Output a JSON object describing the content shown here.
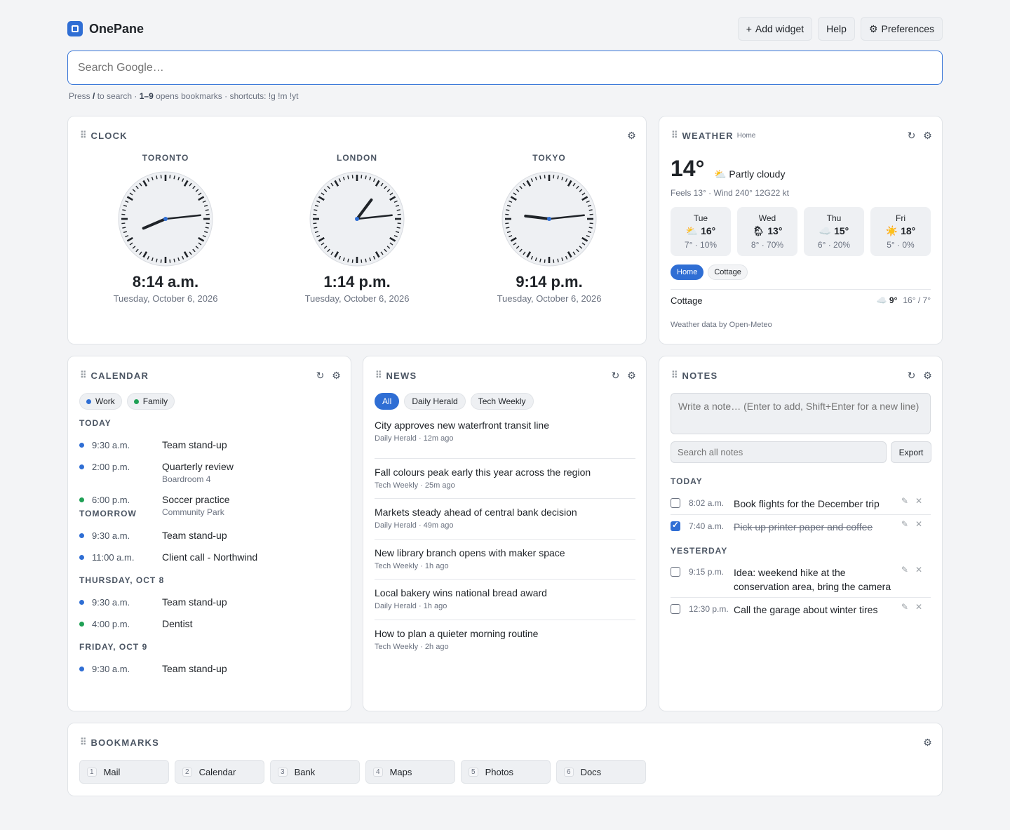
{
  "app": {
    "name": "OnePane"
  },
  "header": {
    "add_widget": "Add widget",
    "help": "Help",
    "preferences": "Preferences"
  },
  "search": {
    "placeholder": "Search Google…"
  },
  "hint": {
    "p1": "Press ",
    "k1": "/",
    "p2": " to search · ",
    "k2": "1–9",
    "p3": " opens bookmarks · shortcuts: !g !m !yt"
  },
  "clock": {
    "title": "CLOCK",
    "cities": [
      {
        "name": "TORONTO",
        "time": "8:14 a.m.",
        "date": "Tuesday, October 6, 2026",
        "hour": 8,
        "minute": 14
      },
      {
        "name": "LONDON",
        "time": "1:14 p.m.",
        "date": "Tuesday, October 6, 2026",
        "hour": 13,
        "minute": 14
      },
      {
        "name": "TOKYO",
        "time": "9:14 p.m.",
        "date": "Tuesday, October 6, 2026",
        "hour": 21,
        "minute": 14
      }
    ]
  },
  "weather": {
    "title": "WEATHER",
    "location": "Home",
    "temp": "14°",
    "condition": "Partly cloudy",
    "condition_icon": "⛅",
    "feels": "Feels 13° · Wind 240° 12G22 kt",
    "forecast": [
      {
        "day": "Tue",
        "icon": "⛅",
        "hi": "16°",
        "lo": "7° · 10%"
      },
      {
        "day": "Wed",
        "icon": "🌦",
        "hi": "13°",
        "lo": "8° · 70%"
      },
      {
        "day": "Thu",
        "icon": "☁️",
        "hi": "15°",
        "lo": "6° · 20%"
      },
      {
        "day": "Fri",
        "icon": "☀️",
        "hi": "18°",
        "lo": "5° · 0%"
      }
    ],
    "locations": [
      "Home",
      "Cottage"
    ],
    "secondary": {
      "name": "Cottage",
      "icon": "☁️",
      "now": "9°",
      "range": "16° / 7°"
    },
    "credit": "Weather data by Open-Meteo"
  },
  "calendar": {
    "title": "CALENDAR",
    "filters": [
      {
        "label": "Work",
        "color": "#2f6ed4"
      },
      {
        "label": "Family",
        "color": "#1fa055"
      }
    ],
    "sections": [
      {
        "label": "TODAY",
        "events": [
          {
            "time": "9:30 a.m.",
            "name": "Team stand-up",
            "sub": "",
            "color": "#2f6ed4"
          },
          {
            "time": "2:00 p.m.",
            "name": "Quarterly review",
            "sub": "Boardroom 4",
            "color": "#2f6ed4"
          },
          {
            "time": "6:00 p.m.",
            "name": "Soccer practice",
            "sub": "Community Park",
            "color": "#1fa055"
          }
        ]
      },
      {
        "label": "TOMORROW",
        "events": [
          {
            "time": "9:30 a.m.",
            "name": "Team stand-up",
            "sub": "",
            "color": "#2f6ed4"
          },
          {
            "time": "11:00 a.m.",
            "name": "Client call - Northwind",
            "sub": "",
            "color": "#2f6ed4"
          }
        ]
      },
      {
        "label": "THURSDAY, OCT 8",
        "events": [
          {
            "time": "9:30 a.m.",
            "name": "Team stand-up",
            "sub": "",
            "color": "#2f6ed4"
          },
          {
            "time": "4:00 p.m.",
            "name": "Dentist",
            "sub": "",
            "color": "#1fa055"
          }
        ]
      },
      {
        "label": "FRIDAY, OCT 9",
        "events": [
          {
            "time": "9:30 a.m.",
            "name": "Team stand-up",
            "sub": "",
            "color": "#2f6ed4"
          }
        ]
      }
    ]
  },
  "news": {
    "title": "NEWS",
    "filters": [
      "All",
      "Daily Herald",
      "Tech Weekly"
    ],
    "items": [
      {
        "headline": "City approves new waterfront transit line",
        "meta": "Daily Herald · 12m ago"
      },
      {
        "headline": "Fall colours peak early this year across the region",
        "meta": "Tech Weekly · 25m ago"
      },
      {
        "headline": "Markets steady ahead of central bank decision",
        "meta": "Daily Herald · 49m ago"
      },
      {
        "headline": "New library branch opens with maker space",
        "meta": "Tech Weekly · 1h ago"
      },
      {
        "headline": "Local bakery wins national bread award",
        "meta": "Daily Herald · 1h ago"
      },
      {
        "headline": "How to plan a quieter morning routine",
        "meta": "Tech Weekly · 2h ago"
      }
    ]
  },
  "notes": {
    "title": "NOTES",
    "input_placeholder": "Write a note… (Enter to add, Shift+Enter for a new line)",
    "search_placeholder": "Search all notes",
    "export": "Export",
    "sections": [
      {
        "label": "TODAY",
        "notes": [
          {
            "time": "8:02 a.m.",
            "text": "Book flights for the December trip",
            "done": false
          },
          {
            "time": "7:40 a.m.",
            "text": "Pick up printer paper and coffee",
            "done": true
          }
        ]
      },
      {
        "label": "YESTERDAY",
        "notes": [
          {
            "time": "9:15 p.m.",
            "text": "Idea: weekend hike at the conservation area, bring the camera",
            "done": false
          },
          {
            "time": "12:30 p.m.",
            "text": "Call the garage about winter tires",
            "done": false
          }
        ]
      }
    ]
  },
  "bookmarks": {
    "title": "BOOKMARKS",
    "items": [
      {
        "key": "1",
        "label": "Mail"
      },
      {
        "key": "2",
        "label": "Calendar"
      },
      {
        "key": "3",
        "label": "Bank"
      },
      {
        "key": "4",
        "label": "Maps"
      },
      {
        "key": "5",
        "label": "Photos"
      },
      {
        "key": "6",
        "label": "Docs"
      }
    ]
  }
}
